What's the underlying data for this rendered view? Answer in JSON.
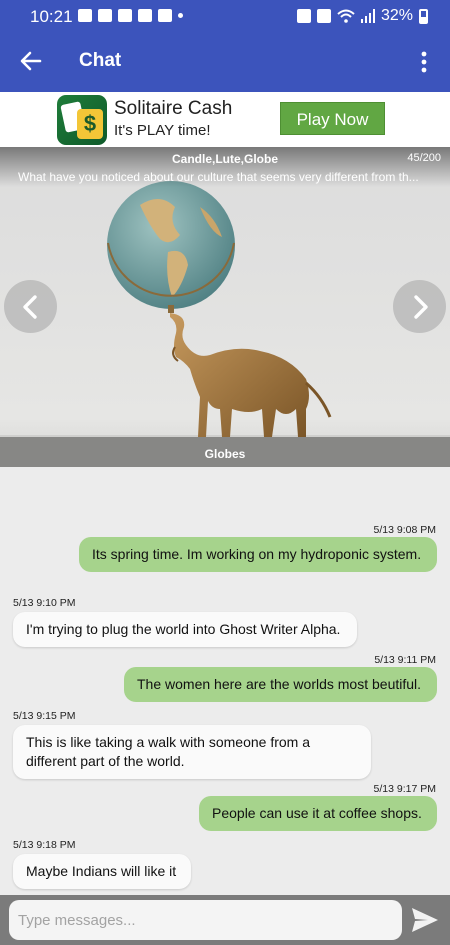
{
  "status_bar": {
    "time": "10:21",
    "battery": "32%",
    "icons": [
      "calendar-icon",
      "twitter-icon",
      "news-icon",
      "fitness-icon",
      "camera-icon",
      "dot-icon",
      "alarm-icon",
      "mute-icon",
      "wifi-icon",
      "signal-icon",
      "battery-icon"
    ]
  },
  "app_bar": {
    "title": "Chat",
    "back_icon": "arrow-left-icon",
    "menu_icon": "more-vert-icon"
  },
  "ad": {
    "app_name": "Solitaire Cash",
    "tagline": "It's PLAY time!",
    "cta": "Play Now",
    "logo_glyph": "$",
    "cta_color": "#61a743"
  },
  "prompt": {
    "keywords": "Candle,Lute,Globe",
    "counter": "45/200",
    "question": "What have you noticed about our culture that seems very different from  th...",
    "caption": "Globes"
  },
  "messages": [
    {
      "dir": "out",
      "time": "5/13 9:08 PM",
      "text": "Its spring time.  Im working on my hydroponic system."
    },
    {
      "dir": "in",
      "time": "5/13 9:10 PM",
      "text": "I'm trying to plug the world into Ghost Writer Alpha."
    },
    {
      "dir": "out",
      "time": "5/13 9:11 PM",
      "text": "The women here are the worlds most beutiful."
    },
    {
      "dir": "in",
      "time": "5/13 9:15 PM",
      "text": "This is like taking a walk with someone from a different part of the world."
    },
    {
      "dir": "out",
      "time": "5/13 9:17 PM",
      "text": "People can use it at coffee shops."
    },
    {
      "dir": "in",
      "time": "5/13 9:18 PM",
      "text": "Maybe Indians will like it"
    }
  ],
  "input": {
    "placeholder": "Type messages..."
  },
  "colors": {
    "primary": "#3c54bc",
    "outgoing_bubble": "#a6d38c",
    "incoming_bubble": "#fafafa"
  }
}
